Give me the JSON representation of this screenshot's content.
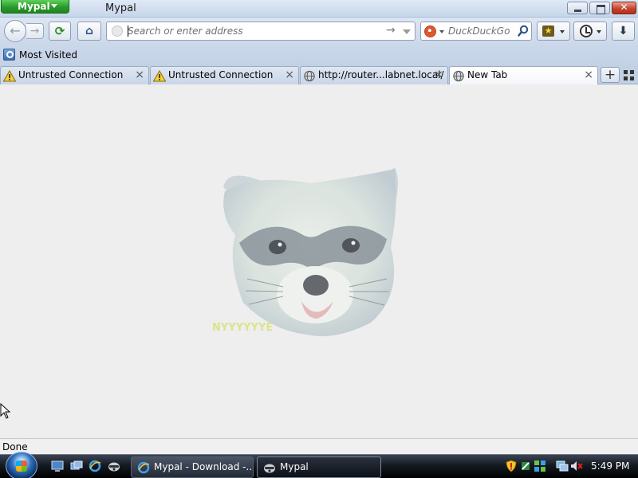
{
  "window": {
    "app_button_label": "Mypal",
    "title": "Mypal",
    "close_glyph": "✕"
  },
  "navbar": {
    "url_placeholder": "Search or enter address",
    "search_placeholder": "DuckDuckGo",
    "reload_glyph": "⟳",
    "home_glyph": "⌂",
    "download_glyph": "⬇",
    "bookmark_star_glyph": "★"
  },
  "bookmarks_bar": {
    "items": [
      {
        "label": "Most Visited",
        "icon": "most-visited-icon"
      }
    ]
  },
  "tabs": [
    {
      "label": "Untrusted Connection",
      "icon": "warning-icon",
      "selected": false
    },
    {
      "label": "Untrusted Connection",
      "icon": "warning-icon",
      "selected": false
    },
    {
      "label": "http://router...labnet.local/",
      "icon": "globe-icon",
      "selected": false
    },
    {
      "label": "New Tab",
      "icon": "globe-icon",
      "selected": true
    }
  ],
  "tab_controls": {
    "close_glyph": "×",
    "new_tab_glyph": "+"
  },
  "content": {
    "image": "raccoon-logo",
    "image_caption": "NYYYYYYE"
  },
  "status": {
    "text": "Done"
  },
  "taskbar": {
    "buttons": [
      {
        "label": "Mypal - Download -...",
        "icon": "ie-icon",
        "active": false
      },
      {
        "label": "Mypal",
        "icon": "raccoon-icon",
        "active": true
      }
    ],
    "clock": "5:49 PM"
  },
  "colors": {
    "app_button": "#2a9a2a",
    "duckduckgo": "#de5833",
    "close_button": "#c7432f"
  }
}
